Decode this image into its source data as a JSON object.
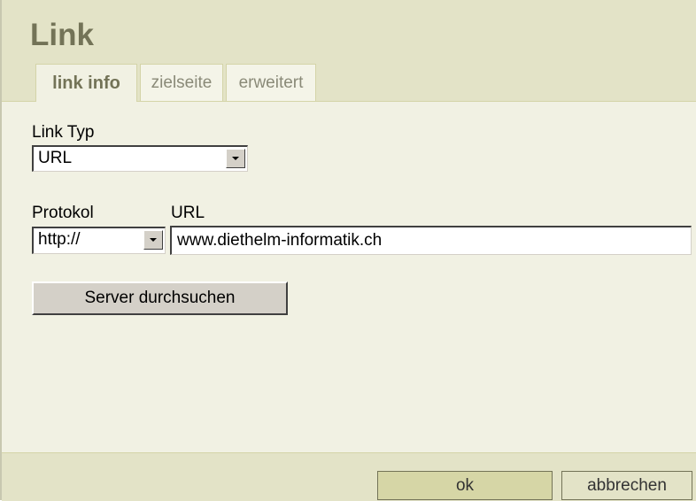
{
  "dialog": {
    "title": "Link",
    "tabs": [
      {
        "label": "link info",
        "active": true
      },
      {
        "label": "zielseite",
        "active": false
      },
      {
        "label": "erweitert",
        "active": false
      }
    ]
  },
  "form": {
    "link_type_label": "Link Typ",
    "link_type_value": "URL",
    "protocol_label": "Protokol",
    "protocol_value": "http://",
    "url_label": "URL",
    "url_value": "www.diethelm-informatik.ch",
    "browse_server_label": "Server durchsuchen"
  },
  "footer": {
    "ok_label": "ok",
    "cancel_label": "abbrechen"
  },
  "colors": {
    "header_bg": "#e3e3c7",
    "body_bg": "#f1f1e3",
    "title": "#737357",
    "ok_button": "#d6d6a6"
  }
}
